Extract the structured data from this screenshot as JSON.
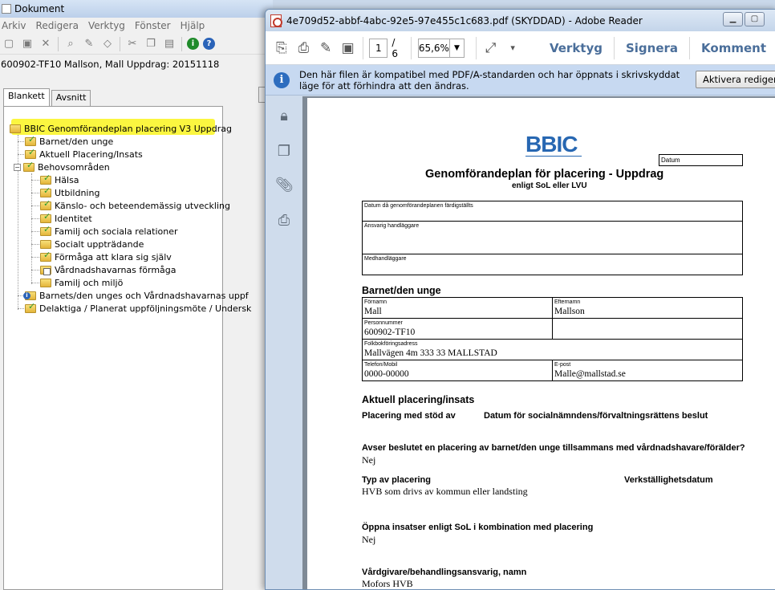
{
  "doc_window": {
    "title": "Dokument",
    "menu": [
      "Arkiv",
      "Redigera",
      "Verktyg",
      "Fönster",
      "Hjälp"
    ],
    "case_line": "600902-TF10 Mallson, Mall   Uppdrag: 20151118",
    "tabs": [
      "Blankett",
      "Avsnitt"
    ],
    "tree": {
      "root": "BBIC Genomförandeplan placering V3 Uppdrag",
      "items": [
        "Barnet/den unge",
        "Aktuell Placering/Insats",
        "Behovsområden",
        "Hälsa",
        "Utbildning",
        "Känslo- och beteendemässig utveckling",
        "Identitet",
        "Familj och sociala relationer",
        "Socialt uppträdande",
        "Förmåga att klara sig själv",
        "Vårdnadshavarnas förmåga",
        "Familj och miljö",
        "Barnets/den unges och Vårdnadshavarnas uppf",
        "Delaktiga / Planerat uppföljningsmöte / Undersk"
      ]
    },
    "highlight_color": "#fbf536"
  },
  "reader_window": {
    "title": "4e709d52-abbf-4abc-92e5-97e455c1c683.pdf (SKYDDAD) - Adobe Reader",
    "page_current": "1",
    "page_total": "/ 6",
    "zoom": "65,6%",
    "links": [
      "Verktyg",
      "Signera",
      "Komment"
    ],
    "info_message": "Den här filen är kompatibel med PDF/A-standarden och har öppnats i skrivskyddat läge för att förhindra att den ändras.",
    "activate_button": "Aktivera redigerin",
    "accent": "#4a6e9a"
  },
  "pdf": {
    "logo": "BBIC",
    "datum_label": "Datum",
    "title": "Genomförandeplan för placering - Uppdrag",
    "subtitle": "enligt SoL eller LVU",
    "fields_top": [
      {
        "label": "Datum då genomförandeplanen färdigställts"
      },
      {
        "label": "Ansvarig handläggare"
      },
      {
        "label": "Medhandläggare"
      }
    ],
    "barnet": {
      "heading": "Barnet/den unge",
      "fornamn_label": "Förnamn",
      "fornamn": "Mall",
      "efternamn_label": "Efternamn",
      "efternamn": "Mallson",
      "personnummer_label": "Personnummer",
      "personnummer": "600902-TF10",
      "adress_label": "Folkbokföringsadress",
      "adress": "Mallvägen 4m 333 33 MALLSTAD",
      "telefon_label": "Telefon/Mobil",
      "telefon": "0000-00000",
      "epost_label": "E-post",
      "epost": "Malle@mallstad.se"
    },
    "placering": {
      "heading": "Aktuell placering/insats",
      "stod_label": "Placering med stöd av",
      "datum_beslut_label": "Datum för socialnämndens/förvaltningsrättens beslut",
      "q1": "Avser beslutet en placering av barnet/den unge tillsammans med vårdnadshavare/förälder?",
      "a1": "Nej",
      "typ_label": "Typ av placering",
      "typ": "HVB som drivs av kommun eller landsting",
      "verk_label": "Verkställighetsdatum",
      "q2": "Öppna insatser enligt SoL i kombination med placering",
      "a2": "Nej",
      "vard_label": "Vårdgivare/behandlingsansvarig, namn",
      "vard": "Mofors HVB"
    }
  }
}
